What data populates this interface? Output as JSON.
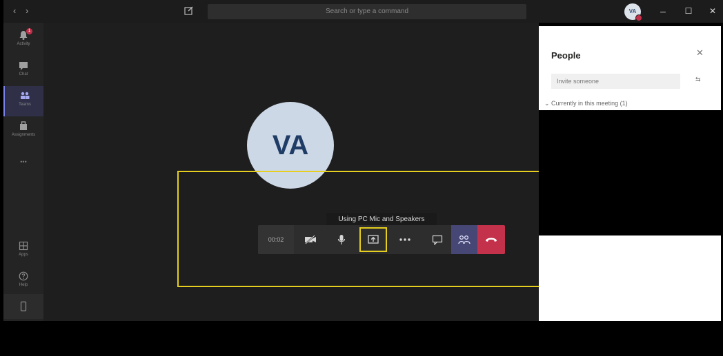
{
  "titlebar": {
    "back_icon": "‹",
    "forward_icon": "›",
    "search_placeholder": "Search or type a command",
    "avatar_initials": "VA",
    "minimize": "–",
    "maximize": "☐",
    "close": "✕"
  },
  "rail": {
    "items": [
      {
        "label": "Activity",
        "icon": "bell-icon",
        "badge": "1"
      },
      {
        "label": "Chat",
        "icon": "chat-icon"
      },
      {
        "label": "Teams",
        "icon": "teams-icon"
      },
      {
        "label": "Assignments",
        "icon": "assignments-icon"
      },
      {
        "label": "•••",
        "icon": "more-icon"
      },
      {
        "label": "Apps",
        "icon": "apps-icon"
      },
      {
        "label": "Help",
        "icon": "help-icon"
      }
    ]
  },
  "stage": {
    "participant_initials": "VA",
    "tooltip": "Using PC Mic and Speakers"
  },
  "controls": {
    "timer": "00:02",
    "buttons": [
      "camera-off",
      "microphone",
      "share-screen",
      "more-options",
      "show-conversation",
      "show-participants",
      "hang-up"
    ]
  },
  "people_panel": {
    "title": "People",
    "close": "✕",
    "invite_placeholder": "Invite someone",
    "invite_option": "⇆",
    "section_label": "Currently in this meeting (1)"
  },
  "colors": {
    "highlight": "#e6cf1e",
    "hangup": "#c4314b",
    "people_btn": "#464775"
  }
}
